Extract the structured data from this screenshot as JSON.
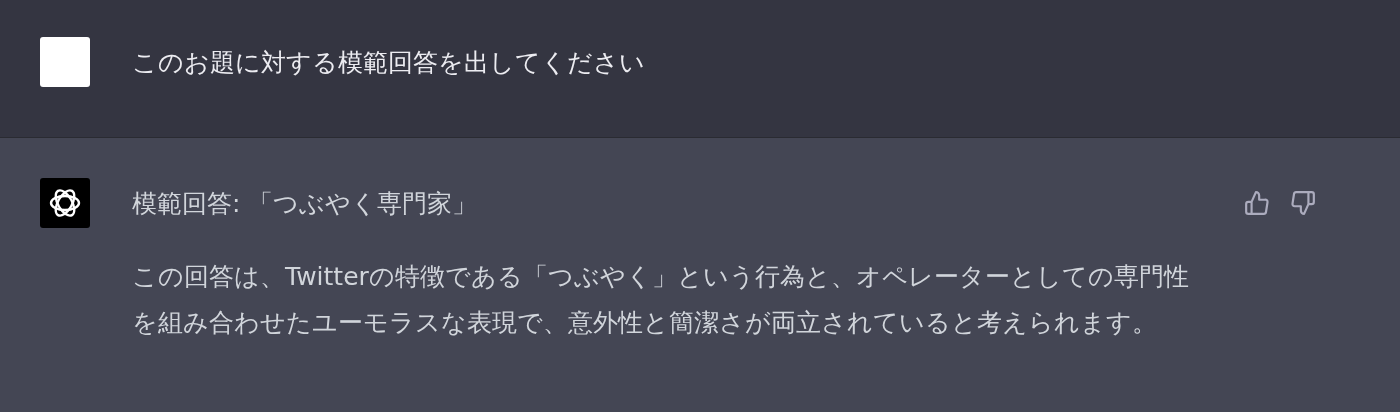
{
  "messages": [
    {
      "kind": "user",
      "title": "このお題に対する模範回答を出してください"
    },
    {
      "kind": "assistant",
      "title": "模範回答: 「つぶやく専門家」",
      "body": "この回答は、Twitterの特徴である「つぶやく」という行為と、オペレーターとしての専門性を組み合わせたユーモラスな表現で、意外性と簡潔さが両立されていると考えられます。"
    }
  ]
}
